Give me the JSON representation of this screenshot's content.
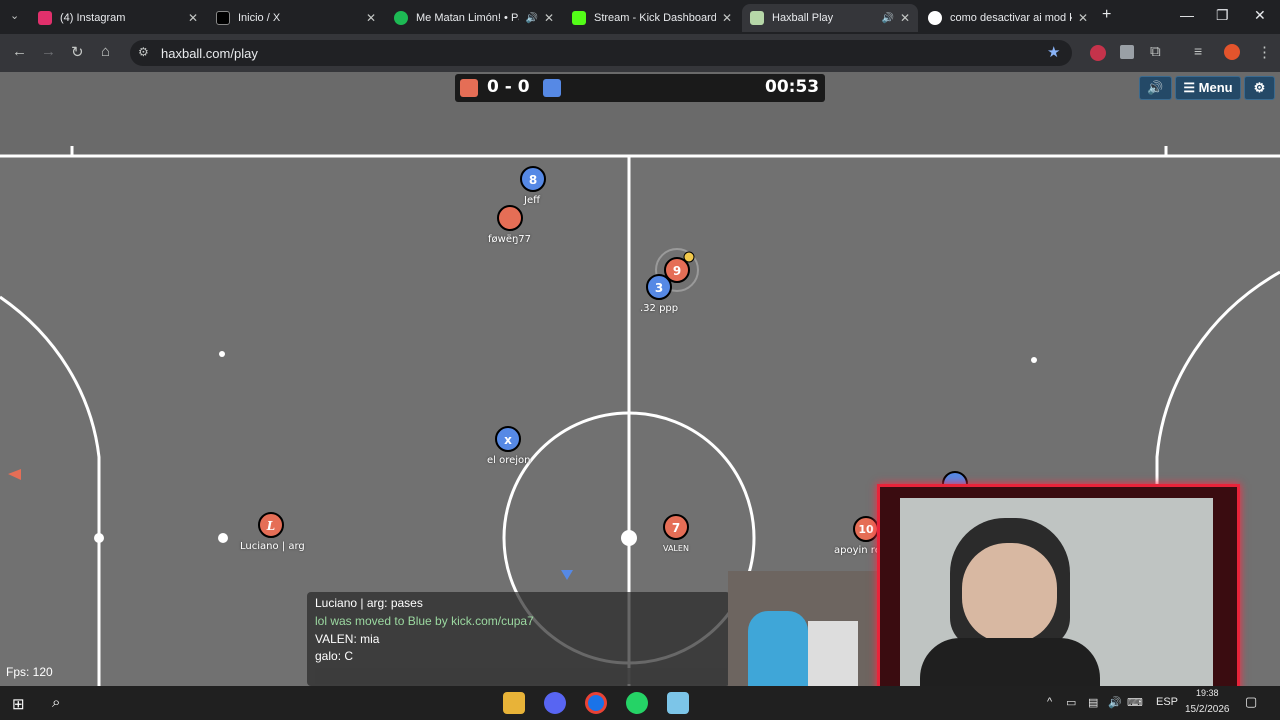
{
  "tabs": [
    {
      "title": "(4) Instagram",
      "icon": "instagram-icon",
      "color": "#e1306c"
    },
    {
      "title": "Inicio / X",
      "icon": "x-logo-icon",
      "color": "#000000"
    },
    {
      "title": "Me Matan Limón! • Pa",
      "icon": "spotify-icon",
      "color": "#1db954"
    },
    {
      "title": "Stream - Kick Dashboard",
      "icon": "kick-icon",
      "color": "#53fc18"
    },
    {
      "title": "Haxball Play",
      "icon": "haxball-icon",
      "color": "#b6d7a8"
    },
    {
      "title": "como desactivar ai mod k",
      "icon": "google-icon",
      "color": "#4285f4"
    }
  ],
  "address": {
    "url": "haxball.com/play"
  },
  "scoreboard": {
    "score": "0 - 0",
    "time": "00:53",
    "red_color": "#e56e56",
    "blue_color": "#5689e5"
  },
  "game_buttons": {
    "sound": "🔊",
    "menu": "☰ Menu",
    "settings": "⚙"
  },
  "players": [
    {
      "number": "8",
      "name": "Jeff",
      "team": "blue"
    },
    {
      "number": "",
      "name": "føwëŋ77",
      "team": "red"
    },
    {
      "number": "9",
      "name": "",
      "team": "red"
    },
    {
      "number": "3",
      "name": ".32 ppp",
      "team": "blue"
    },
    {
      "number": "x",
      "name": "el orejon",
      "team": "blue"
    },
    {
      "number": "L",
      "name": "Luciano | arg",
      "team": "red"
    },
    {
      "number": "7",
      "name": "VALEN",
      "team": "red"
    },
    {
      "number": "10",
      "name": "apoyin re",
      "team": "red"
    }
  ],
  "chat": {
    "lines": [
      {
        "text": "Luciano | arg: pases"
      },
      {
        "text": "lol was moved to Blue by kick.com/cupa7"
      },
      {
        "text": "VALEN: mia"
      },
      {
        "text": "galo: C"
      }
    ]
  },
  "fps": "Fps: 120",
  "taskbar": {
    "lang": "ESP",
    "date": "15/2/2026",
    "time": "19:38"
  }
}
